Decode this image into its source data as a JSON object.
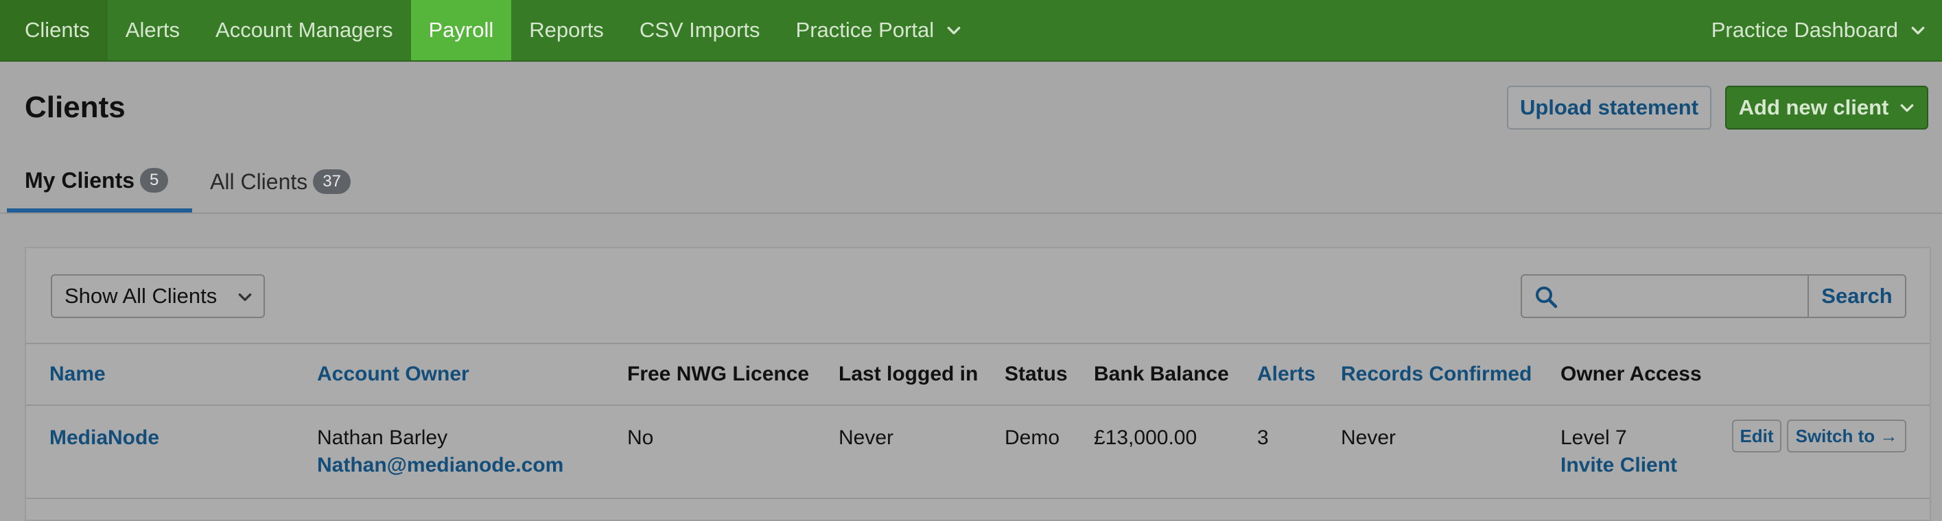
{
  "nav": {
    "items": [
      {
        "label": "Clients"
      },
      {
        "label": "Alerts"
      },
      {
        "label": "Account Managers"
      },
      {
        "label": "Payroll"
      },
      {
        "label": "Reports"
      },
      {
        "label": "CSV Imports"
      },
      {
        "label": "Practice Portal"
      }
    ],
    "right_label": "Practice Dashboard",
    "active": "Payroll"
  },
  "header": {
    "title": "Clients",
    "upload_label": "Upload statement",
    "add_label": "Add new client"
  },
  "tabs": [
    {
      "label": "My Clients",
      "count": "5"
    },
    {
      "label": "All Clients",
      "count": "37"
    }
  ],
  "filter": {
    "selected": "Show All Clients"
  },
  "search": {
    "placeholder": "",
    "button_label": "Search"
  },
  "table": {
    "columns": [
      "Name",
      "Account Owner",
      "Free NWG Licence",
      "Last logged in",
      "Status",
      "Bank Balance",
      "Alerts",
      "Records Confirmed",
      "Owner Access"
    ],
    "rows": [
      {
        "name": "MediaNode",
        "owner_name": "Nathan Barley",
        "owner_email": "Nathan@medianode.com",
        "licence": "No",
        "last_login": "Never",
        "status": "Demo",
        "balance": "£13,000.00",
        "alerts": "3",
        "records": "Never",
        "access_level": "Level 7",
        "invite_label": "Invite Client",
        "edit_label": "Edit",
        "switch_label": "Switch to →"
      }
    ]
  },
  "colors": {
    "nav_bg": "#387b27",
    "nav_active": "#56b53b",
    "link": "#134e7a",
    "tab_underline": "#1f5f96"
  }
}
